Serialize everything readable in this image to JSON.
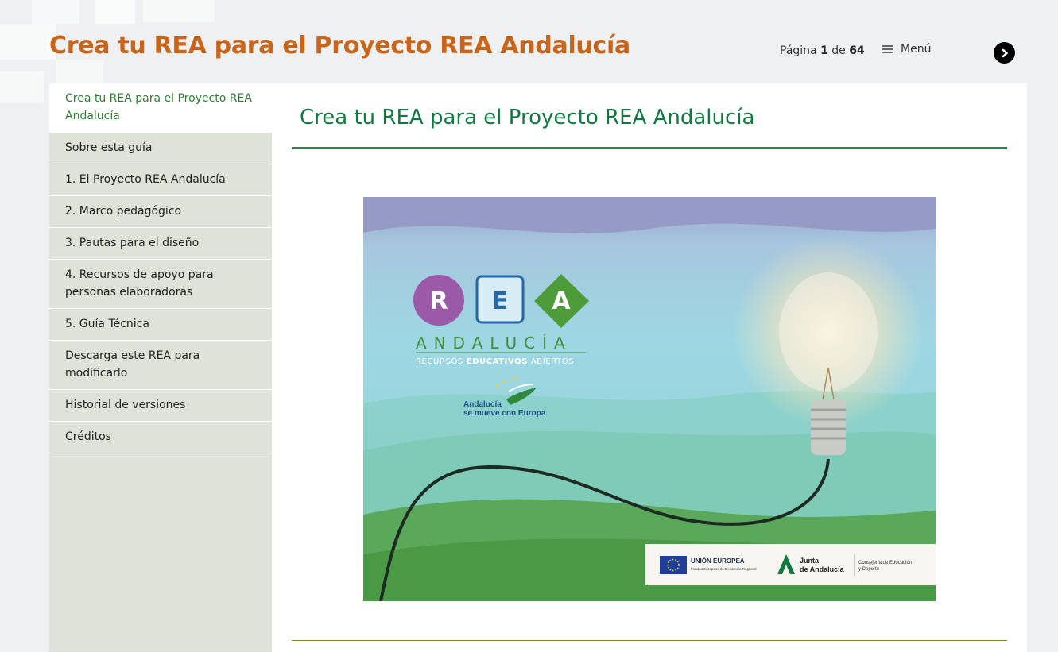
{
  "header": {
    "site_title": "Crea tu REA para el Proyecto REA Andalucía",
    "pager_prefix": "Página",
    "pager_current": "1",
    "pager_sep": "de",
    "pager_total": "64",
    "menu_label": "Menú",
    "menu_icon": "hamburger-icon",
    "next_icon": "chevron-right-icon"
  },
  "sidebar": {
    "items": [
      {
        "label": "Crea tu REA para el Proyecto REA Andalucía",
        "active": true
      },
      {
        "label": "Sobre esta guía"
      },
      {
        "label": "1. El Proyecto REA Andalucía"
      },
      {
        "label": "2. Marco pedagógico"
      },
      {
        "label": "3. Pautas para el diseño"
      },
      {
        "label": "4. Recursos de apoyo para personas elaboradoras"
      },
      {
        "label": "5. Guía Técnica"
      },
      {
        "label": "Descarga este REA para modificarlo"
      },
      {
        "label": "Historial de versiones"
      },
      {
        "label": "Créditos"
      }
    ]
  },
  "main": {
    "title": "Crea tu REA para el Proyecto REA Andalucía",
    "cover": {
      "logo_letters": [
        "R",
        "E",
        "A"
      ],
      "logo_word": "ANDALUCÍA",
      "logo_tagline_1": "RECURSOS ",
      "logo_tagline_2": "EDUCATIVOS",
      "logo_tagline_3": " ABIERTOS",
      "badge_line1": "Andalucía",
      "badge_line2": "se mueve con Europa",
      "eu_title": "UNIÓN EUROPEA",
      "eu_sub": "Fondos Europeos de Desarrollo Regional",
      "junta_line1": "Junta",
      "junta_line2": "de Andalucía",
      "consejeria_line1": "Consejería de Educación",
      "consejeria_line2": "y Deporte"
    }
  },
  "colors": {
    "title_orange": "#c8651b",
    "accent_green": "#0f7a3f",
    "sidebar_bg": "#dee2d8"
  }
}
